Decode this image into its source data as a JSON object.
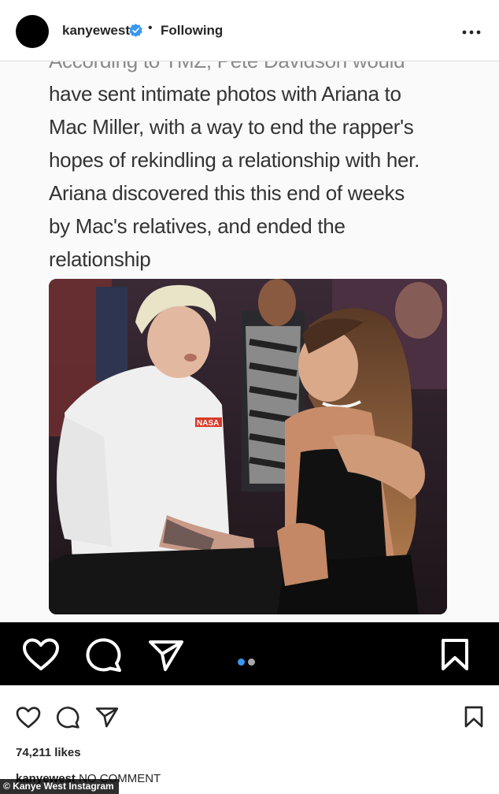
{
  "header": {
    "username": "kanyewest",
    "separator": "•",
    "follow_status": "Following",
    "verified_icon": "verified-badge-icon",
    "more_icon": "more-options-icon"
  },
  "post": {
    "text_cut_line": "According to TMZ, Pete Davidson would",
    "text_lines": [
      "have sent intimate photos with Ariana to",
      "Mac Miller, with a way to end the rapper's",
      "hopes of rekindling a relationship with her.",
      "Ariana discovered this this end of weeks",
      "by Mac's relatives, and ended the",
      "relationship"
    ],
    "photo_shirt_logo": "NASA",
    "carousel": {
      "total": 2,
      "active": 0,
      "active_color": "#3897f0",
      "inactive_color": "#a8a8a8"
    }
  },
  "inner_bar": {
    "icons": [
      "heart-icon",
      "comment-icon",
      "share-icon",
      "bookmark-icon"
    ]
  },
  "actions": {
    "icons": [
      "heart-icon",
      "comment-icon",
      "share-icon",
      "bookmark-icon"
    ],
    "likes": "74,211 likes",
    "caption_user": "kanyewest",
    "caption_text": "NO COMMENT"
  },
  "credit": "© Kanye West Instagram"
}
